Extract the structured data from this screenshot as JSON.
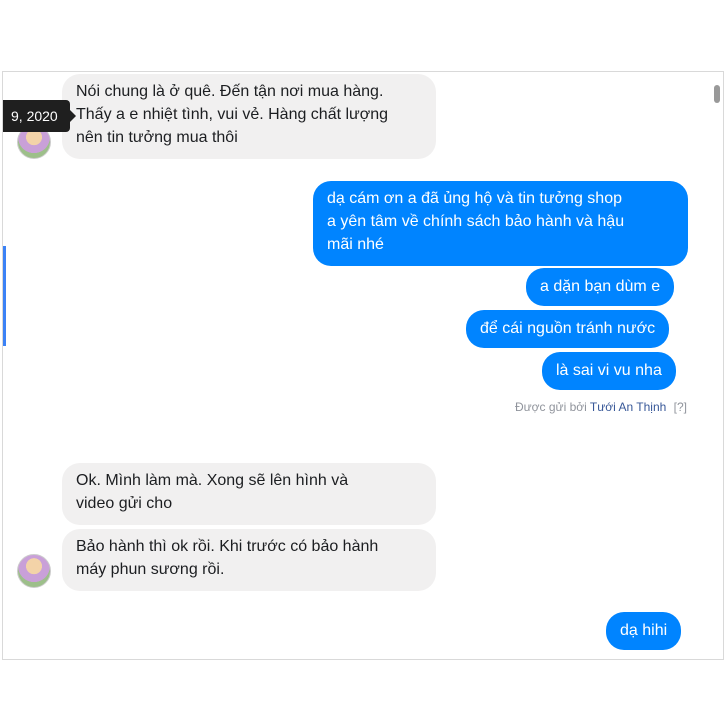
{
  "tooltip": {
    "date": "9, 2020"
  },
  "messages": {
    "in_1": [
      "Nói chung là ở quê. Đến tận nơi mua hàng.",
      "Thấy a e nhiệt tình, vui vẻ. Hàng chất lượng",
      "nên tin tưởng mua thôi"
    ],
    "out_1": [
      "dạ cám ơn a đã ủng hộ và tin tưởng shop",
      "a yên tâm về chính sách bảo hành và hậu",
      "mãi nhé"
    ],
    "out_2": "a dặn bạn dùm e",
    "out_3": "để cái nguồn tránh nước",
    "out_4": "là sai vi vu nha",
    "in_2": [
      "Ok. Mình làm mà. Xong sẽ lên hình và",
      "video gửi cho"
    ],
    "in_3": [
      "Bảo hành thì ok rồi. Khi trước có bảo hành",
      "máy phun sương rồi."
    ],
    "out_5": "dạ hihi"
  },
  "sent_by": {
    "prefix": "Được gửi bởi",
    "name": "Tưới An Thịnh",
    "help": "[?]"
  },
  "colors": {
    "outgoing": "#0084ff",
    "incoming": "#f1f0f0",
    "link": "#385898"
  }
}
